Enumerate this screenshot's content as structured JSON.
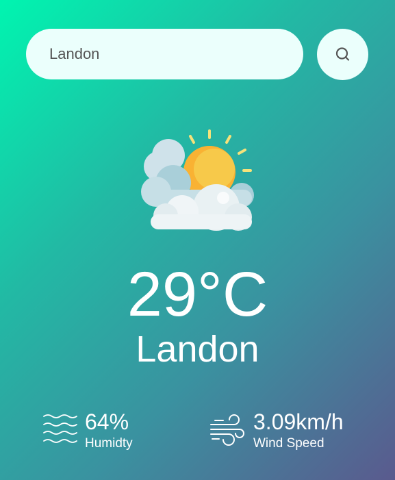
{
  "search": {
    "value": "Landon",
    "icon": "search-icon"
  },
  "weather": {
    "icon": "partly-cloudy-icon",
    "temperature": "29°C",
    "city": "Landon"
  },
  "details": {
    "humidity": {
      "icon": "humidity-icon",
      "value": "64%",
      "label": "Humidty"
    },
    "wind": {
      "icon": "wind-icon",
      "value": "3.09km/h",
      "label": "Wind Speed"
    }
  },
  "colors": {
    "gradient_start": "#00f5b0",
    "gradient_end": "#5a5a8e",
    "search_bg": "#ebfffc",
    "text": "#ffffff"
  }
}
